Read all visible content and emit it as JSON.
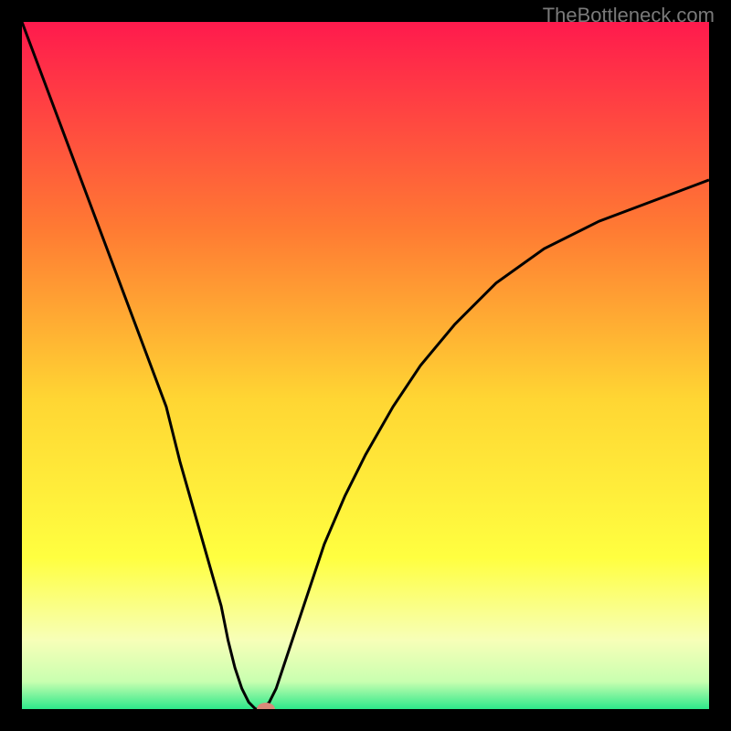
{
  "watermark": "TheBottleneck.com",
  "chart_data": {
    "type": "line",
    "title": "",
    "xlabel": "",
    "ylabel": "",
    "xlim": [
      0,
      100
    ],
    "ylim": [
      0,
      100
    ],
    "background_gradient": {
      "top": "#ff1a4d",
      "mid": "#ffeb2b",
      "bottom_band": "#f7ffb8",
      "bottom": "#2de88a"
    },
    "series": [
      {
        "name": "bottleneck-curve",
        "x": [
          0,
          3,
          6,
          9,
          12,
          15,
          18,
          21,
          23,
          25,
          27,
          29,
          30,
          31,
          32,
          33,
          34,
          35,
          36,
          37,
          38,
          40,
          42,
          44,
          47,
          50,
          54,
          58,
          63,
          69,
          76,
          84,
          92,
          100
        ],
        "values": [
          100,
          92,
          84,
          76,
          68,
          60,
          52,
          44,
          36,
          29,
          22,
          15,
          10,
          6,
          3,
          1,
          0,
          0,
          1,
          3,
          6,
          12,
          18,
          24,
          31,
          37,
          44,
          50,
          56,
          62,
          67,
          71,
          74,
          77
        ]
      }
    ],
    "marker": {
      "name": "optimal-point",
      "x": 35.5,
      "y": 0,
      "color": "#d88a7a",
      "rx": 10,
      "ry": 7
    }
  }
}
